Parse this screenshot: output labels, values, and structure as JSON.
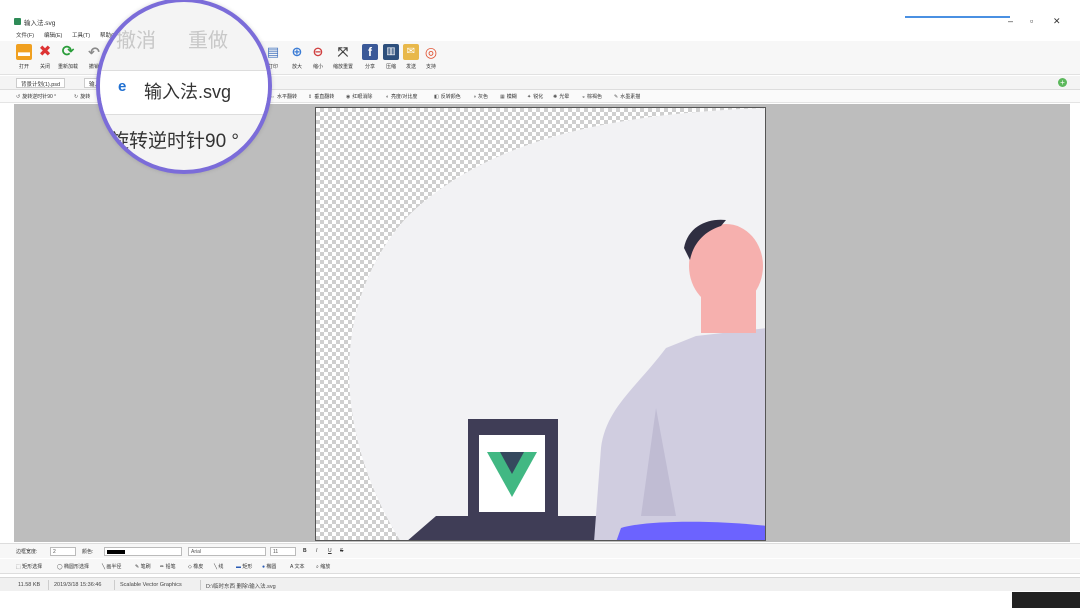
{
  "window": {
    "title": "输入法.svg",
    "controls": {
      "minimize": "–",
      "maximize": "▫",
      "close": "✕"
    }
  },
  "menu": [
    "文件(F)",
    "编辑(E)",
    "工具(T)",
    "帮助(H)"
  ],
  "toolbar": {
    "items": [
      {
        "label": "打开",
        "icon": "folder-icon",
        "color": "#f0a020"
      },
      {
        "label": "关闭",
        "icon": "close-icon",
        "color": "#d33"
      },
      {
        "label": "重新加载",
        "icon": "reload-icon",
        "color": "#2a9d3a"
      },
      {
        "label": "撤销",
        "icon": "undo-icon",
        "color": "#8a8a8a"
      },
      {
        "label": "打印",
        "icon": "print-icon",
        "color": "#4a78c0"
      },
      {
        "label": "放大",
        "icon": "zoom-in-icon",
        "color": "#3a7bd5"
      },
      {
        "label": "缩小",
        "icon": "zoom-out-icon",
        "color": "#d04040"
      },
      {
        "label": "缩放重置",
        "icon": "fit-icon",
        "color": "#444"
      },
      {
        "label": "分享",
        "icon": "facebook-icon",
        "color": "#3b5998"
      },
      {
        "label": "压缩",
        "icon": "compress-icon",
        "color": "#2d4f7c"
      },
      {
        "label": "发送",
        "icon": "mail-icon",
        "color": "#e8b84a"
      },
      {
        "label": "支持",
        "icon": "lifebuoy-icon",
        "color": "#e05030"
      }
    ]
  },
  "tabs": [
    "背景计划(1).psd",
    "输入法.svg"
  ],
  "image_ops": {
    "items": [
      "旋转逆时针90 °",
      "旋转",
      "水平翻转",
      "垂直翻转",
      "红眼消除",
      "亮度/对比度",
      "反转颜色",
      "灰色",
      "模糊",
      "锐化",
      "光晕",
      "棕褐色",
      "水墨素描"
    ]
  },
  "zoom_overlay": {
    "undo": "撤消",
    "redo": "重做",
    "file_tab": "输入法.svg",
    "rotate": "旋转逆时针90 °"
  },
  "style_bar": {
    "width_label": "边框宽度:",
    "width_value": "2",
    "color_label": "颜色:",
    "font_value": "Arial",
    "size_value": "11",
    "bold": "B",
    "italic": "I",
    "underline": "U",
    "strike": "S"
  },
  "draw_tools": [
    "矩形选择",
    "椭圆形选择",
    "画半径",
    "笔刷",
    "铅笔",
    "橡皮",
    "线",
    "矩形",
    "椭圆",
    "文本",
    "缩放"
  ],
  "status": {
    "size": "11.58 KB",
    "date": "2019/3/18 15:36:46",
    "type": "Scalable Vector Graphics",
    "path": "D:\\临时东西 删除\\输入法.svg"
  },
  "colors": {
    "zoom_ring": "#7b6cd9",
    "vue_green": "#41b883",
    "vue_dark": "#35495e",
    "skin": "#f6b0ae",
    "shirt": "#cfcbe0",
    "frame": "#3f3d56"
  }
}
